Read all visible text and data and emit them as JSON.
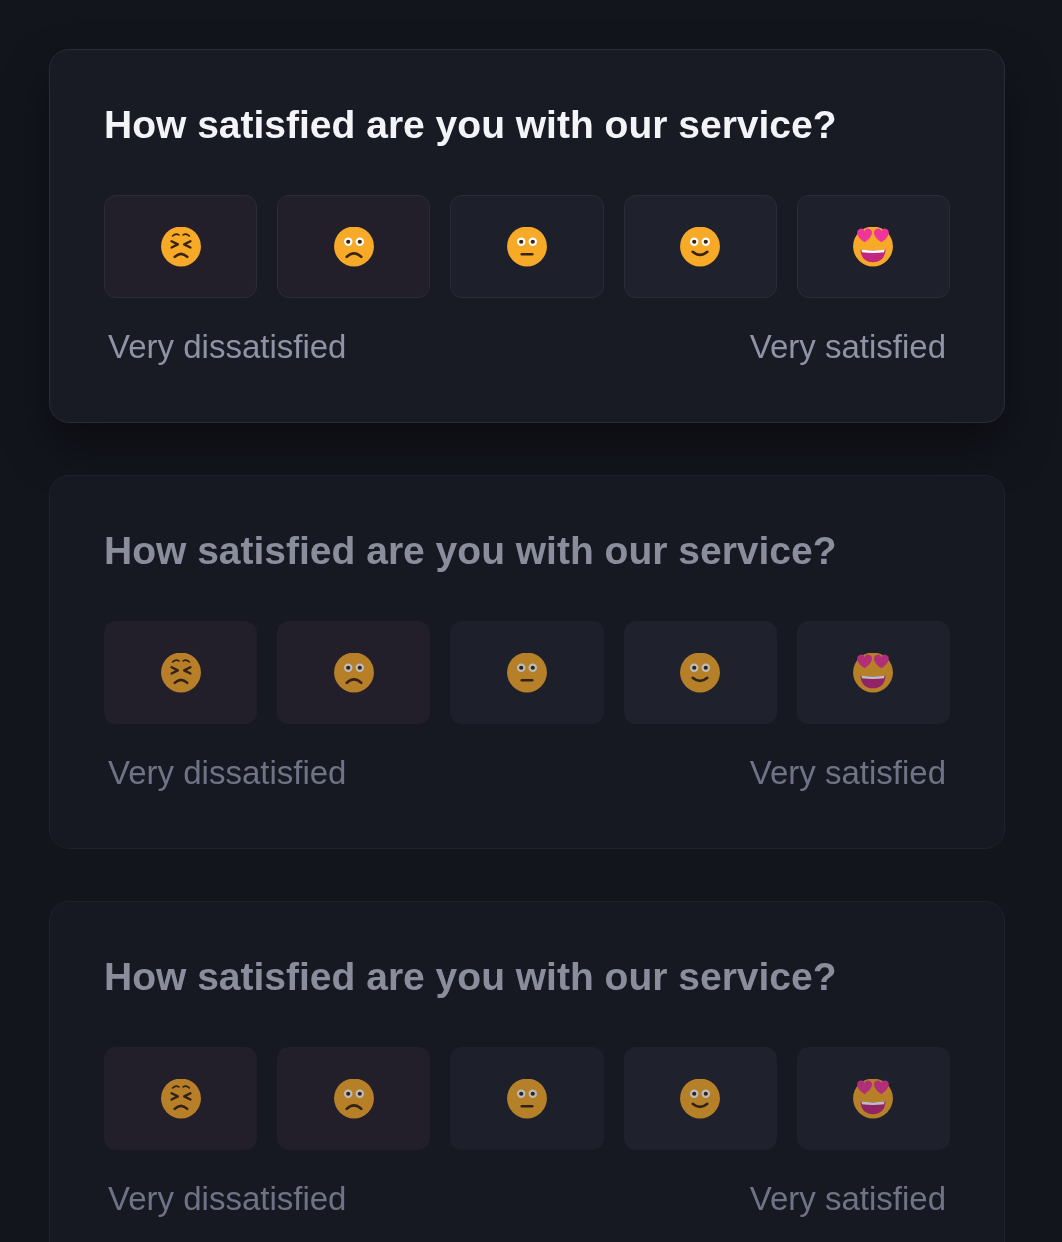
{
  "cards": [
    {
      "dimmed": false,
      "question": "How satisfied are you with our service?",
      "options": [
        {
          "kind": "persevering",
          "color": "#221f2a"
        },
        {
          "kind": "frowning",
          "color": "#221f2a"
        },
        {
          "kind": "neutral",
          "color": "#1d202b"
        },
        {
          "kind": "smiling",
          "color": "#1f222c"
        },
        {
          "kind": "hearteyes",
          "color": "#1e212c"
        }
      ],
      "scale_labels": {
        "low": "Very dissatisfied",
        "high": "Very satisfied"
      }
    },
    {
      "dimmed": true,
      "question": "How satisfied are you with our service?",
      "options": [
        {
          "kind": "persevering",
          "color": "#221f2a"
        },
        {
          "kind": "frowning",
          "color": "#221f2a"
        },
        {
          "kind": "neutral",
          "color": "#1d202b"
        },
        {
          "kind": "smiling",
          "color": "#1f222c"
        },
        {
          "kind": "hearteyes",
          "color": "#1e212c"
        }
      ],
      "scale_labels": {
        "low": "Very dissatisfied",
        "high": "Very satisfied"
      }
    },
    {
      "dimmed": true,
      "question": "How satisfied are you with our service?",
      "options": [
        {
          "kind": "persevering",
          "color": "#221f2a"
        },
        {
          "kind": "frowning",
          "color": "#221f2a"
        },
        {
          "kind": "neutral",
          "color": "#1d202b"
        },
        {
          "kind": "smiling",
          "color": "#1f222c"
        },
        {
          "kind": "hearteyes",
          "color": "#1e212c"
        }
      ],
      "scale_labels": {
        "low": "Very dissatisfied",
        "high": "Very satisfied"
      }
    }
  ]
}
